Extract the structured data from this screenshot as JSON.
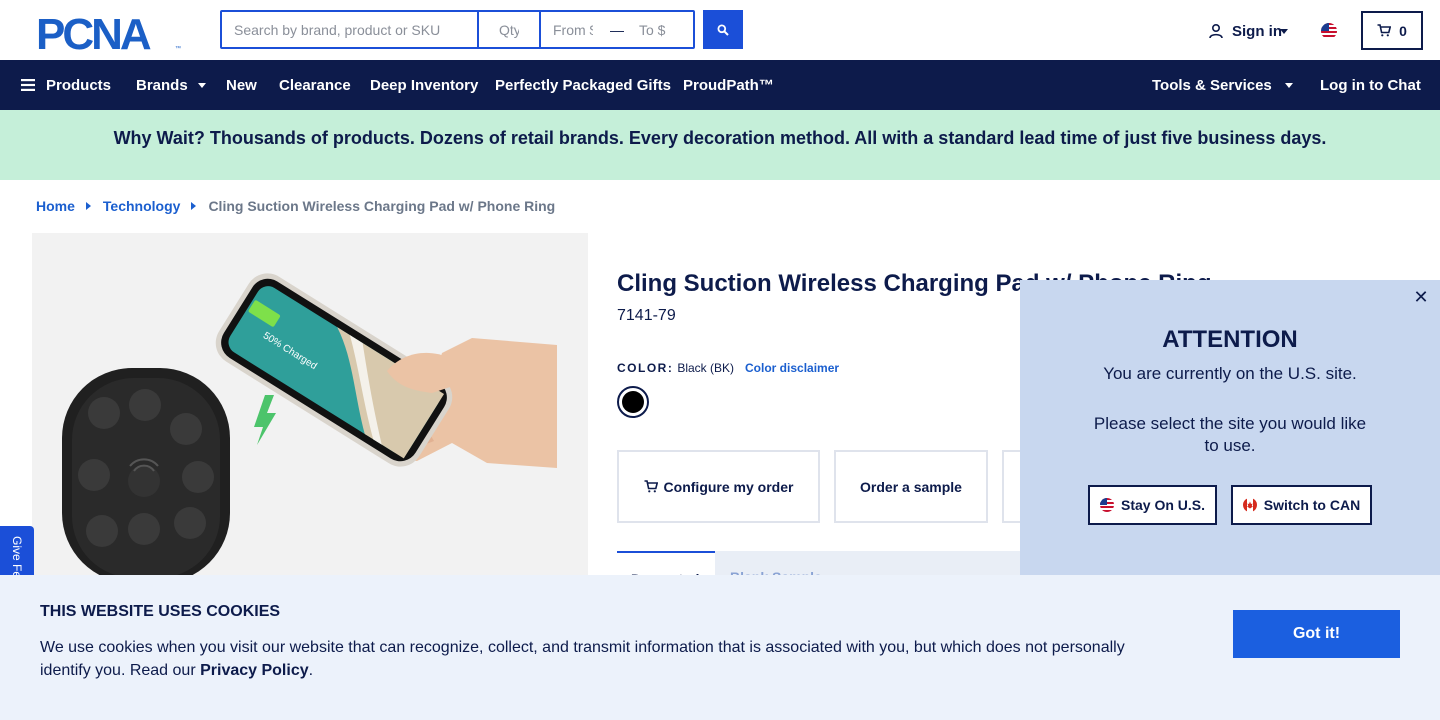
{
  "header": {
    "logo_text": "PCNA",
    "search_placeholder": "Search by brand, product or SKU",
    "qty_placeholder": "Qty",
    "from_placeholder": "From $",
    "to_placeholder": "To $",
    "signin_label": "Sign in",
    "cart_count": "0"
  },
  "nav": {
    "products": "Products",
    "brands": "Brands",
    "new": "New",
    "clearance": "Clearance",
    "deep_inventory": "Deep Inventory",
    "gifts": "Perfectly Packaged Gifts",
    "proudpath": "ProudPath™",
    "tools": "Tools & Services",
    "chat": "Log in to Chat"
  },
  "banner": {
    "text": "Why Wait? Thousands of products. Dozens of retail brands. Every decoration method. All with a standard lead time of just five business days."
  },
  "breadcrumb": {
    "home": "Home",
    "category": "Technology",
    "current": "Cling Suction Wireless Charging Pad w/ Phone Ring"
  },
  "product": {
    "title": "Cling Suction Wireless Charging Pad w/ Phone Ring",
    "sku": "7141-79",
    "color_label": "COLOR:",
    "color_value": "Black (BK)",
    "color_disclaimer": "Color disclaimer",
    "swatch_color": "#000000",
    "phone_screen_text": "50% Charged",
    "configure_label": "Configure my order",
    "sample_label": "Order a sample",
    "tab_active": "Decorated",
    "tab_two": "Blank Sample"
  },
  "feedback": {
    "label": "Give Feedback"
  },
  "attention": {
    "title": "ATTENTION",
    "line1": "You are currently on the U.S. site.",
    "line2": "Please select the site you would like to use.",
    "stay_label": "Stay On U.S.",
    "switch_label": "Switch to CAN"
  },
  "cookie": {
    "title": "THIS WEBSITE USES COOKIES",
    "text": "We use cookies when you visit our website that can recognize, collect, and transmit information that is associated with you, but which does not personally identify you. Read our",
    "policy_link": "Privacy Policy",
    "period": ".",
    "button": "Got it!"
  },
  "colors": {
    "navy": "#0d1b4b",
    "accent_blue": "#1b4fd8",
    "banner_green": "#c5efd9",
    "modal_bg": "#c8d7ef",
    "cookie_bg": "#ecf2fb"
  }
}
